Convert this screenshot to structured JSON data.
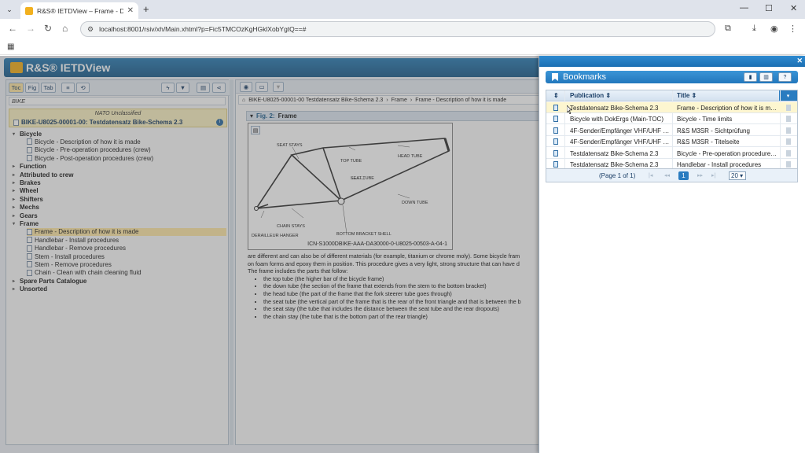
{
  "browser": {
    "tab_title": "R&S® IETDView – Frame - Desc",
    "url": "localhost:8001/rsiv/xh/Main.xhtml?p=Fic5TMCOzKgHGklXobYgtQ==#"
  },
  "app": {
    "name": "R&S® IETDView"
  },
  "left": {
    "tabs": [
      "Toc",
      "Fig",
      "Tab"
    ],
    "search_value": "BIKE",
    "classification": "NATO Unclassified",
    "document": "BIKE-U8025-00001-00: Testdatensatz Bike-Schema 2.3",
    "tree": [
      {
        "label": "Bicycle",
        "type": "cat",
        "open": true
      },
      {
        "label": "Bicycle - Description of how it is made",
        "type": "leaf"
      },
      {
        "label": "Bicycle - Pre-operation procedures (crew)",
        "type": "leaf"
      },
      {
        "label": "Bicycle - Post-operation procedures (crew)",
        "type": "leaf"
      },
      {
        "label": "Function",
        "type": "cat"
      },
      {
        "label": "Attributed to crew",
        "type": "cat"
      },
      {
        "label": "Brakes",
        "type": "cat"
      },
      {
        "label": "Wheel",
        "type": "cat"
      },
      {
        "label": "Shifters",
        "type": "cat"
      },
      {
        "label": "Mechs",
        "type": "cat"
      },
      {
        "label": "Gears",
        "type": "cat"
      },
      {
        "label": "Frame",
        "type": "cat",
        "open": true
      },
      {
        "label": "Frame - Description of how it is made",
        "type": "leaf",
        "selected": true
      },
      {
        "label": "Handlebar - Install procedures",
        "type": "leaf"
      },
      {
        "label": "Handlebar - Remove procedures",
        "type": "leaf"
      },
      {
        "label": "Stem - Install procedures",
        "type": "leaf"
      },
      {
        "label": "Stem - Remove procedures",
        "type": "leaf"
      },
      {
        "label": "Chain - Clean with chain cleaning fluid",
        "type": "leaf"
      },
      {
        "label": "Spare Parts Catalogue",
        "type": "cat"
      },
      {
        "label": "Unsorted",
        "type": "cat"
      }
    ]
  },
  "content": {
    "breadcrumb": [
      "BIKE-U8025-00001-00  Testdatensatz Bike-Schema 2.3",
      "Frame",
      "Frame - Description of how it is made"
    ],
    "figure_label": "Fig. 2:",
    "figure_title": "Frame",
    "figure_labels": {
      "seat_stays": "SEAT STAYS",
      "top_tube": "TOP TUBE",
      "head_tube": "HEAD TUBE",
      "seat_tube": "SEAT TUBE",
      "down_tube": "DOWN TUBE",
      "chain_stays": "CHAIN STAYS",
      "derailleur_hanger": "DERAILLEUR HANGER",
      "bottom_bracket_shell": "BOTTOM BRACKET SHELL"
    },
    "icn": "ICN-S1000DBIKE-AAA-DA30000-0-U8025-00503-A-04-1",
    "para1": "are different and can also be of different materials (for example, titanium or chrome moly). Some bicycle fram",
    "para2": "on foam forms and epoxy them in position. This procedure gives a very light, strong structure that can have d",
    "para3": "The frame includes the parts that follow:",
    "list": [
      "the top tube (the higher bar of the bicycle frame)",
      "the down tube (the section of the frame that extends from the stem to the bottom bracket)",
      "the head tube (the part of the frame that the fork steerer tube goes through)",
      "the seat tube (the vertical part of the frame that is the rear of the front triangle and that is between the b",
      "the seat stay (the tube that includes the distance between the seat tube and the rear dropouts)",
      "the chain stay (the tube that is the bottom part of the rear triangle)"
    ]
  },
  "bookmarks": {
    "title": "Bookmarks",
    "col_publication": "Publication",
    "col_title": "Title",
    "rows": [
      {
        "publication": "Testdatensatz Bike-Schema 2.3",
        "title": "Frame - Description of how it is made"
      },
      {
        "publication": "Bicycle with DokErgs (Main-TOC)",
        "title": "Bicycle - Time limits"
      },
      {
        "publication": "4F-Sender/Empfänger VHF/UHF R&S M3SR",
        "title": "R&S M3SR - Sichtprüfung"
      },
      {
        "publication": "4F-Sender/Empfänger VHF/UHF R&S M3SR",
        "title": "R&S M3SR - Titelseite"
      },
      {
        "publication": "Testdatensatz Bike-Schema 2.3",
        "title": "Bicycle - Pre-operation procedures (crew)"
      },
      {
        "publication": "Testdatensatz Bike-Schema 2.3",
        "title": "Handlebar - Install procedures"
      }
    ],
    "pager_text": "(Page 1 of 1)",
    "current_page": "1",
    "page_size": "20"
  }
}
